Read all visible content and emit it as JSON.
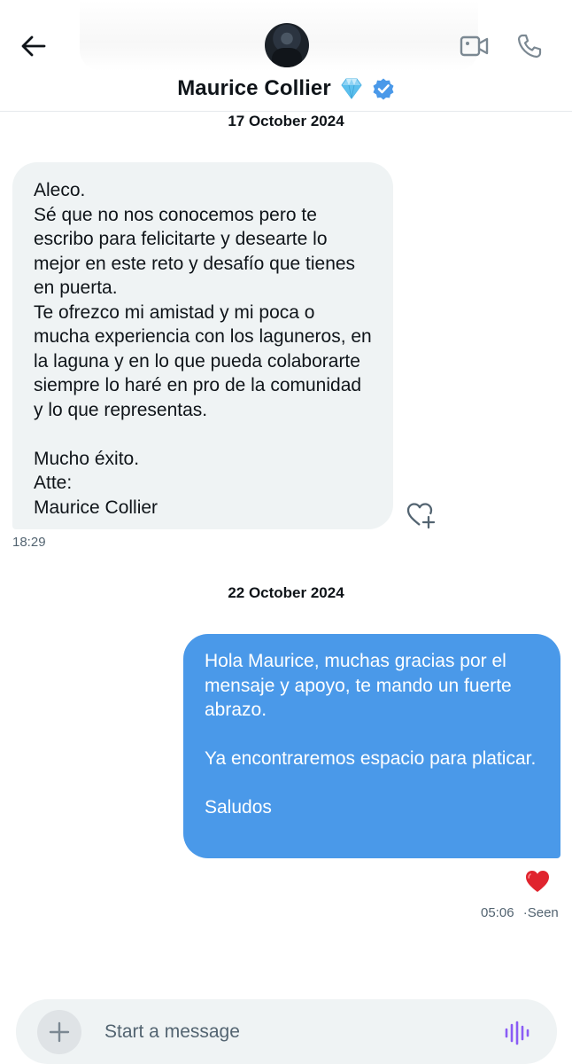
{
  "header": {
    "name": "Maurice Collier",
    "back_icon": "arrow-left-icon",
    "video_icon": "video-camera-icon",
    "call_icon": "phone-icon",
    "badge_icon": "diamond-emoji-icon",
    "verified_icon": "verified-badge-icon",
    "verified_color": "#4a99e9"
  },
  "conversation": {
    "date_1": "17 October 2024",
    "incoming_message": "Aleco.\nSé que no nos conocemos pero te escribo para felicitarte y desearte lo mejor en este reto y desafío que tienes en puerta.\nTe ofrezco mi amistad y mi poca o mucha experiencia con los laguneros, en la laguna y en lo que pueda colaborarte siempre lo haré en pro de la comunidad y lo que representas.\n\nMucho éxito.\nAtte:\nMaurice Collier",
    "incoming_time": "18:29",
    "react_icon": "heart-plus-icon",
    "date_2": "22 October 2024",
    "outgoing_message": "Hola Maurice, muchas gracias por el mensaje y apoyo, te mando un fuerte abrazo.\n\nYa encontraremos espacio para platicar.\n\nSaludos",
    "outgoing_reaction": "❤️",
    "outgoing_time": "05:06",
    "outgoing_status": "Seen",
    "status_separator": "·",
    "outgoing_bubble_color": "#4a99e9",
    "incoming_bubble_color": "#eff3f4"
  },
  "composer": {
    "placeholder": "Start a message",
    "add_icon": "plus-icon",
    "voice_icon": "voice-waveform-icon",
    "voice_color": "#8a5cf5"
  }
}
